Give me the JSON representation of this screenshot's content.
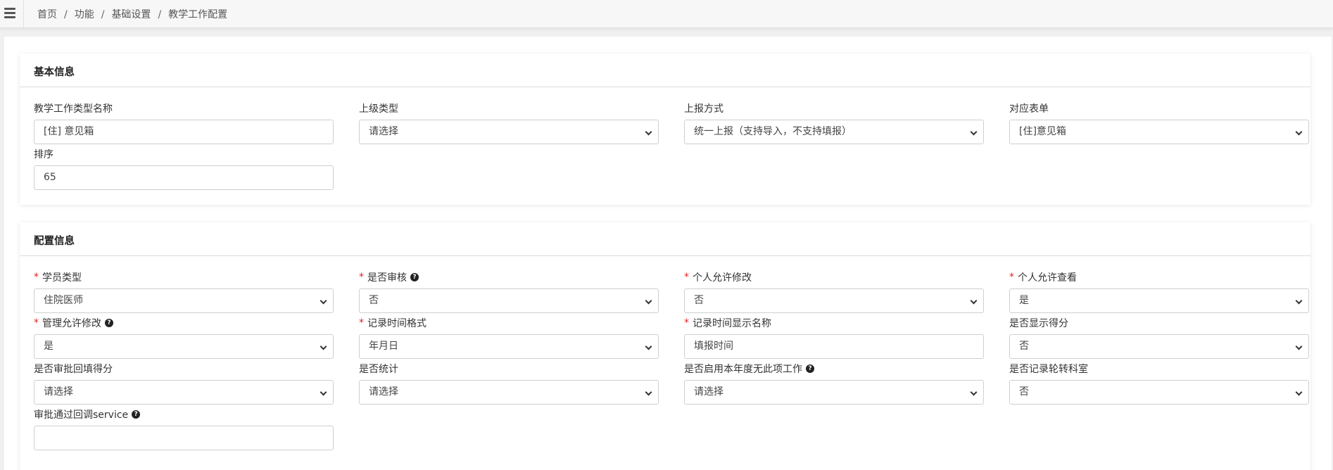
{
  "breadcrumb": [
    {
      "label": "首页"
    },
    {
      "label": "功能"
    },
    {
      "label": "基础设置"
    },
    {
      "label": "教学工作配置"
    }
  ],
  "basic": {
    "title": "基本信息",
    "fields": [
      {
        "label": "教学工作类型名称",
        "type": "input",
        "value": "[住] 意见箱"
      },
      {
        "label": "上级类型",
        "type": "select",
        "value": "请选择"
      },
      {
        "label": "上报方式",
        "type": "select",
        "value": "统一上报（支持导入，不支持填报）"
      },
      {
        "label": "对应表单",
        "type": "select",
        "value": "[住]意见箱"
      },
      {
        "label": "排序",
        "type": "input",
        "value": "65"
      }
    ]
  },
  "config": {
    "title": "配置信息",
    "fields": [
      {
        "label": "学员类型",
        "required": true,
        "help": false,
        "type": "select",
        "value": "住院医师"
      },
      {
        "label": "是否审核",
        "required": true,
        "help": true,
        "type": "select",
        "value": "否"
      },
      {
        "label": "个人允许修改",
        "required": true,
        "help": false,
        "type": "select",
        "value": "否"
      },
      {
        "label": "个人允许查看",
        "required": true,
        "help": false,
        "type": "select",
        "value": "是"
      },
      {
        "label": "管理允许修改",
        "required": true,
        "help": true,
        "type": "select",
        "value": "是"
      },
      {
        "label": "记录时间格式",
        "required": true,
        "help": false,
        "type": "select",
        "value": "年月日"
      },
      {
        "label": "记录时间显示名称",
        "required": true,
        "help": false,
        "type": "input",
        "value": "填报时间"
      },
      {
        "label": "是否显示得分",
        "required": false,
        "help": false,
        "type": "select",
        "value": "否"
      },
      {
        "label": "是否审批回填得分",
        "required": false,
        "help": false,
        "type": "select",
        "value": "请选择"
      },
      {
        "label": "是否统计",
        "required": false,
        "help": false,
        "type": "select",
        "value": "请选择"
      },
      {
        "label": "是否启用本年度无此项工作",
        "required": false,
        "help": true,
        "type": "select",
        "value": "请选择"
      },
      {
        "label": "是否记录轮转科室",
        "required": false,
        "help": false,
        "type": "select",
        "value": "否"
      },
      {
        "label": "审批通过回调service",
        "required": false,
        "help": true,
        "type": "input",
        "value": ""
      }
    ]
  }
}
